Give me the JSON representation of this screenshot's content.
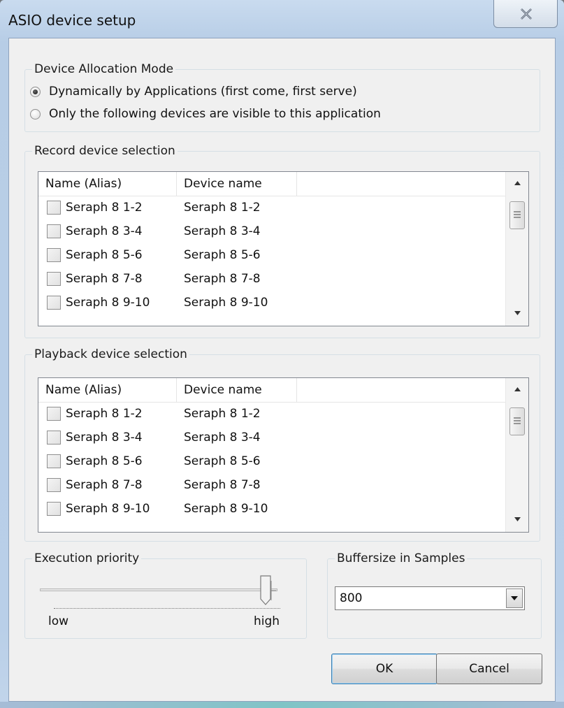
{
  "window": {
    "title": "ASIO device setup",
    "close_icon": "close-x-icon"
  },
  "allocation": {
    "legend": "Device Allocation Mode",
    "options": [
      {
        "label": "Dynamically by Applications (first come, first serve)",
        "checked": true
      },
      {
        "label": "Only the following devices are visible to this application",
        "checked": false
      }
    ]
  },
  "record": {
    "legend": "Record device selection",
    "columns": [
      "Name (Alias)",
      "Device name"
    ],
    "rows": [
      {
        "alias": "Seraph 8 1-2",
        "device": "Seraph 8 1-2",
        "checked": false
      },
      {
        "alias": "Seraph 8 3-4",
        "device": "Seraph 8 3-4",
        "checked": false
      },
      {
        "alias": "Seraph 8 5-6",
        "device": "Seraph 8 5-6",
        "checked": false
      },
      {
        "alias": "Seraph 8 7-8",
        "device": "Seraph 8 7-8",
        "checked": false
      },
      {
        "alias": "Seraph 8 9-10",
        "device": "Seraph 8 9-10",
        "checked": false
      }
    ]
  },
  "playback": {
    "legend": "Playback device selection",
    "columns": [
      "Name (Alias)",
      "Device name"
    ],
    "rows": [
      {
        "alias": "Seraph 8 1-2",
        "device": "Seraph 8 1-2",
        "checked": false
      },
      {
        "alias": "Seraph 8 3-4",
        "device": "Seraph 8 3-4",
        "checked": false
      },
      {
        "alias": "Seraph 8 5-6",
        "device": "Seraph 8 5-6",
        "checked": false
      },
      {
        "alias": "Seraph 8 7-8",
        "device": "Seraph 8 7-8",
        "checked": false
      },
      {
        "alias": "Seraph 8 9-10",
        "device": "Seraph 8 9-10",
        "checked": false
      }
    ]
  },
  "priority": {
    "legend": "Execution priority",
    "low_label": "low",
    "high_label": "high",
    "level": 0.95
  },
  "buffer": {
    "legend": "Buffersize in Samples",
    "value": "800"
  },
  "buttons": {
    "ok": "OK",
    "cancel": "Cancel"
  }
}
